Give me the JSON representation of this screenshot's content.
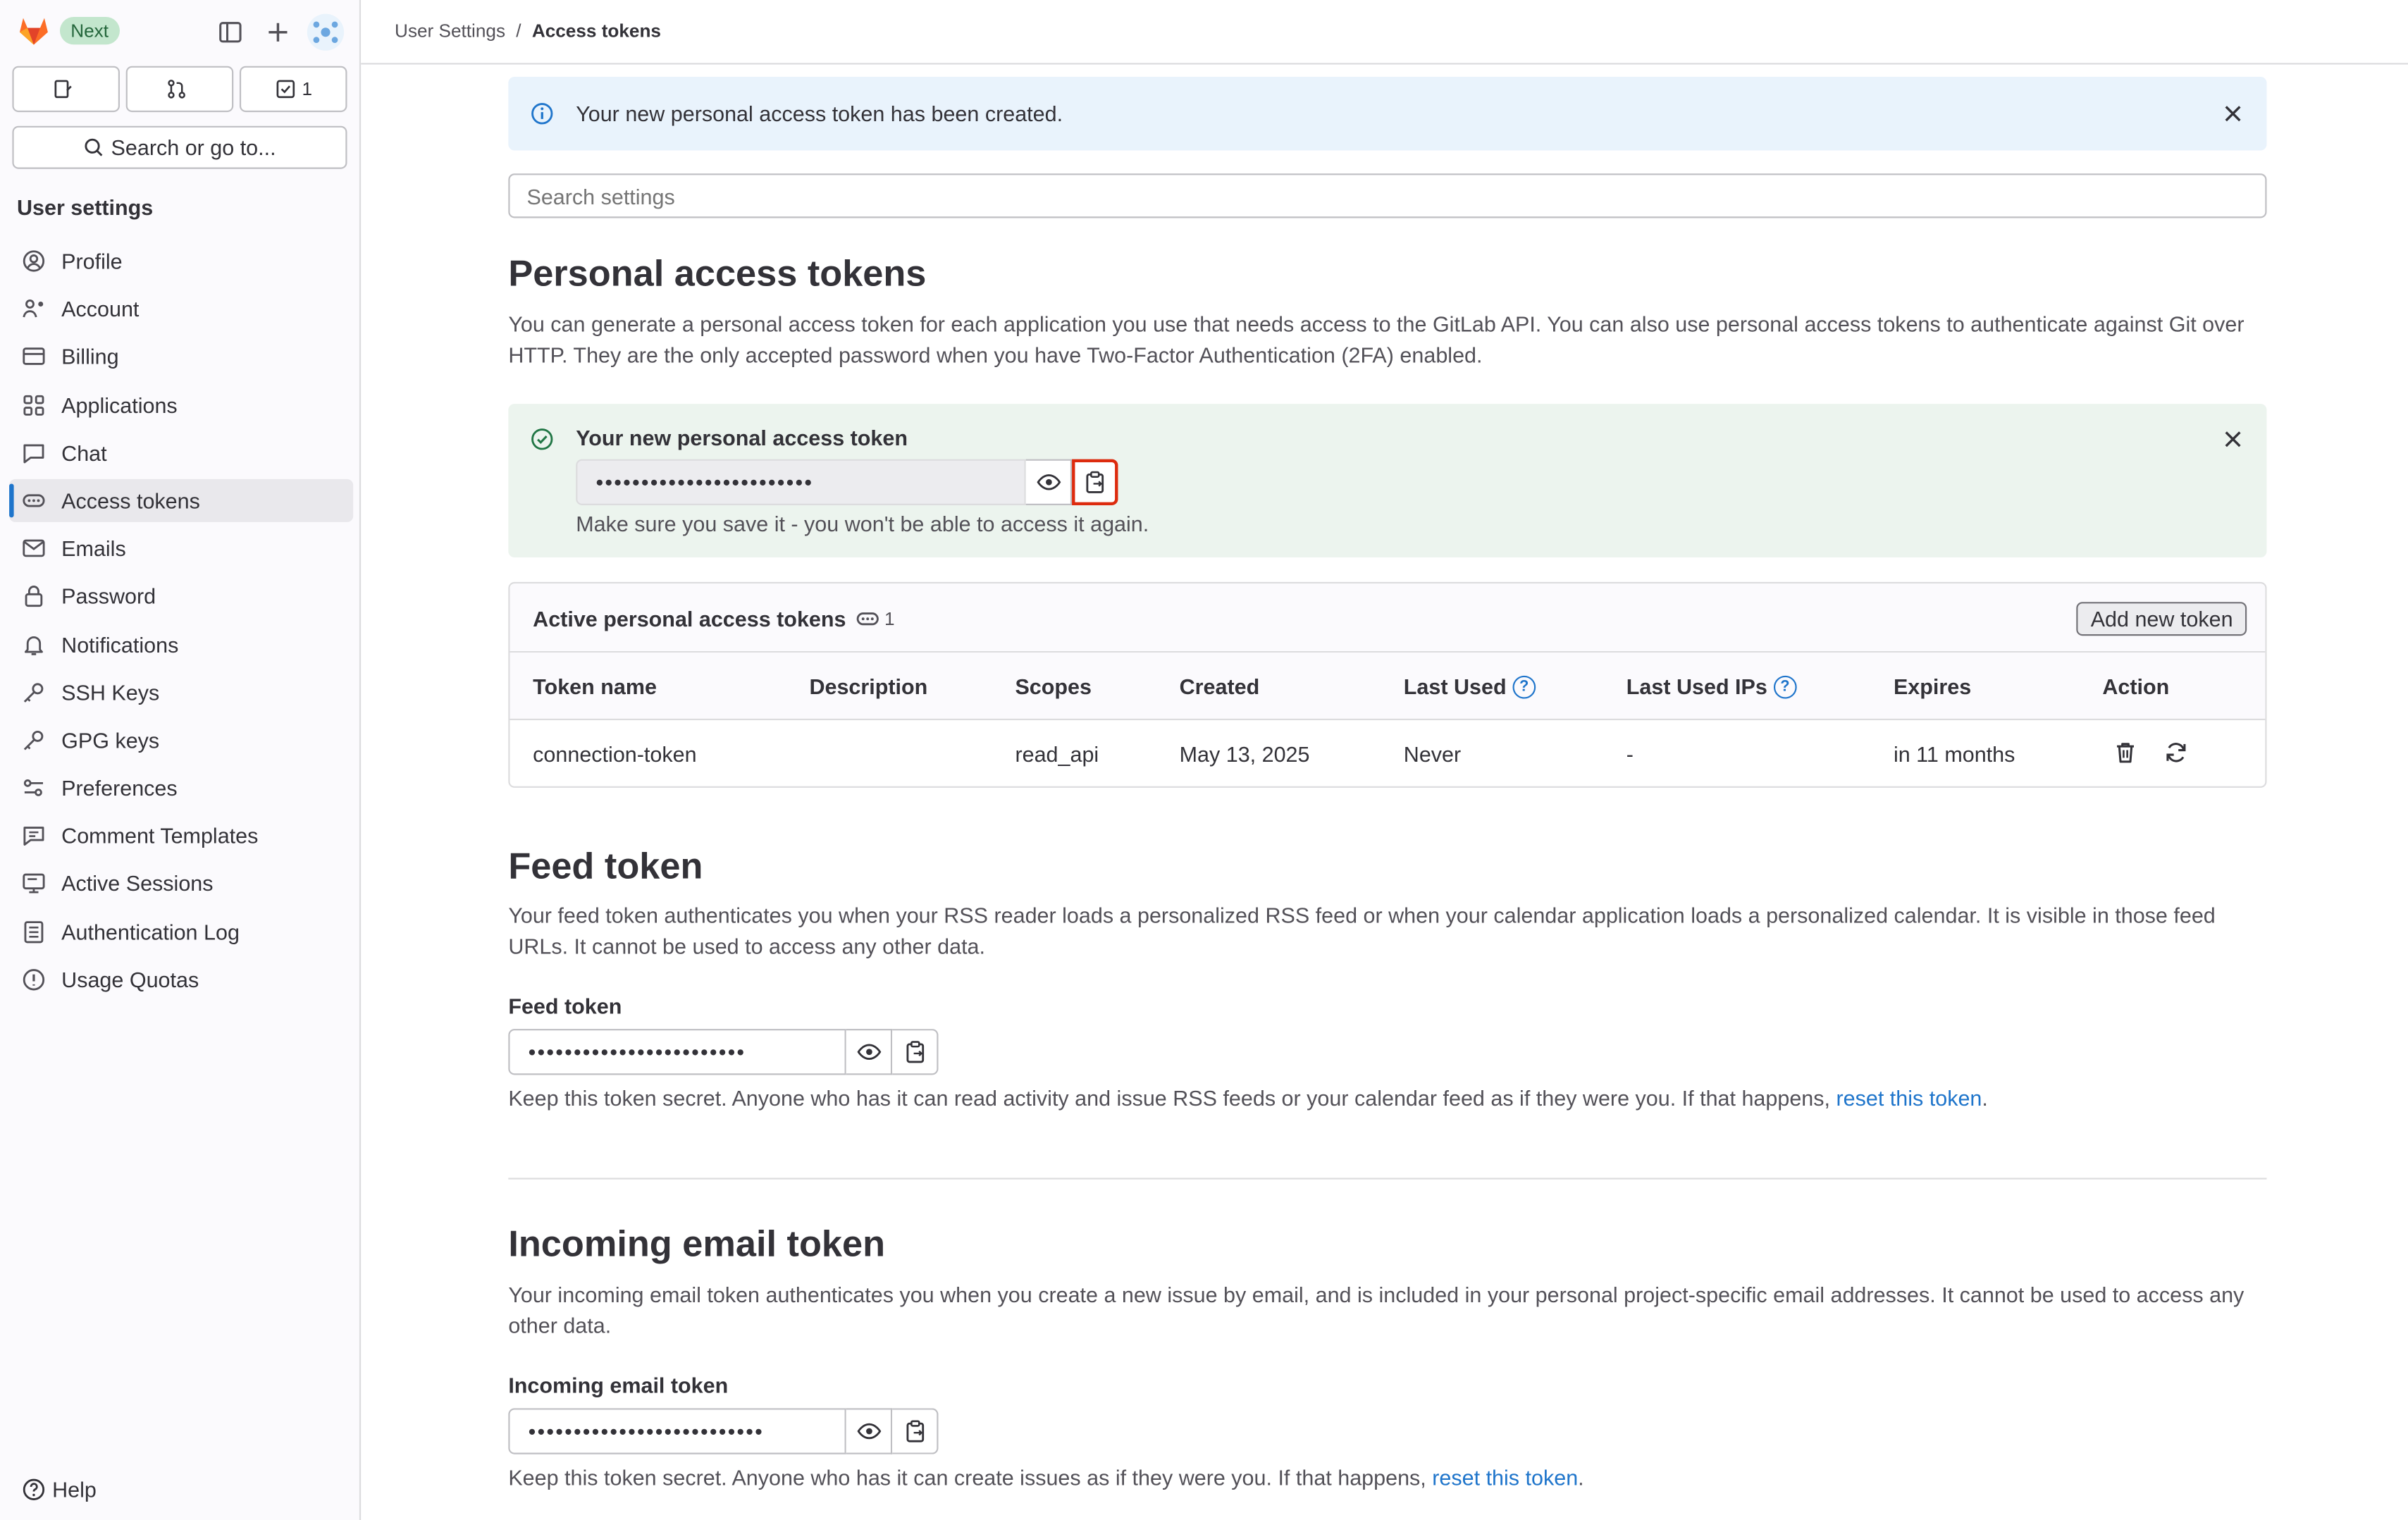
{
  "sidebar": {
    "badge": "Next",
    "buttons": {
      "issues_count": "",
      "mr_count": "",
      "todo_count": "1"
    },
    "search_label": "Search or go to...",
    "heading": "User settings",
    "items": [
      {
        "label": "Profile",
        "icon": "profile-icon"
      },
      {
        "label": "Account",
        "icon": "account-icon"
      },
      {
        "label": "Billing",
        "icon": "billing-icon"
      },
      {
        "label": "Applications",
        "icon": "applications-icon"
      },
      {
        "label": "Chat",
        "icon": "chat-icon"
      },
      {
        "label": "Access tokens",
        "icon": "token-icon",
        "active": true
      },
      {
        "label": "Emails",
        "icon": "mail-icon"
      },
      {
        "label": "Password",
        "icon": "lock-icon"
      },
      {
        "label": "Notifications",
        "icon": "bell-icon"
      },
      {
        "label": "SSH Keys",
        "icon": "key-icon"
      },
      {
        "label": "GPG keys",
        "icon": "key-icon"
      },
      {
        "label": "Preferences",
        "icon": "preferences-icon"
      },
      {
        "label": "Comment Templates",
        "icon": "comment-icon"
      },
      {
        "label": "Active Sessions",
        "icon": "monitor-icon"
      },
      {
        "label": "Authentication Log",
        "icon": "log-icon"
      },
      {
        "label": "Usage Quotas",
        "icon": "quota-icon"
      }
    ],
    "help_label": "Help"
  },
  "breadcrumb": {
    "parent": "User Settings",
    "separator": "/",
    "current": "Access tokens"
  },
  "info_alert": {
    "message": "Your new personal access token has been created."
  },
  "search": {
    "placeholder": "Search settings"
  },
  "pat": {
    "heading": "Personal access tokens",
    "description": "You can generate a personal access token for each application you use that needs access to the GitLab API. You can also use personal access tokens to authenticate against Git over HTTP. They are the only accepted password when you have Two-Factor Authentication (2FA) enabled.",
    "new_token_title": "Your new personal access token",
    "new_token_mask": "••••••••••••••••••••••••",
    "new_token_note": "Make sure you save it - you won't be able to access it again.",
    "active_title": "Active personal access tokens",
    "active_count": "1",
    "add_button": "Add new token",
    "columns": [
      "Token name",
      "Description",
      "Scopes",
      "Created",
      "Last Used",
      "Last Used IPs",
      "Expires",
      "Action"
    ],
    "rows": [
      {
        "name": "connection-token",
        "description": "",
        "scopes": "read_api",
        "created": "May 13, 2025",
        "last_used": "Never",
        "last_used_ips": "-",
        "expires": "in 11 months"
      }
    ]
  },
  "feed": {
    "heading": "Feed token",
    "description": "Your feed token authenticates you when your RSS reader loads a personalized RSS feed or when your calendar application loads a personalized calendar. It is visible in those feed URLs. It cannot be used to access any other data.",
    "label": "Feed token",
    "mask": "••••••••••••••••••••••••",
    "note": "Keep this token secret. Anyone who has it can read activity and issue RSS feeds or your calendar feed as if they were you. If that happens,",
    "link": "reset this token",
    "note_end": "."
  },
  "incoming": {
    "heading": "Incoming email token",
    "description": "Your incoming email token authenticates you when you create a new issue by email, and is included in your personal project-specific email addresses. It cannot be used to access any other data.",
    "label": "Incoming email token",
    "mask": "••••••••••••••••••••••••••",
    "note": "Keep this token secret. Anyone who has it can create issues as if they were you. If that happens,",
    "link": "reset this token",
    "note_end": "."
  },
  "colors": {
    "accent": "#1f75cb",
    "success_bg": "#ecf4ee",
    "info_bg": "#e9f3fc",
    "highlight": "#dd2b0e"
  }
}
